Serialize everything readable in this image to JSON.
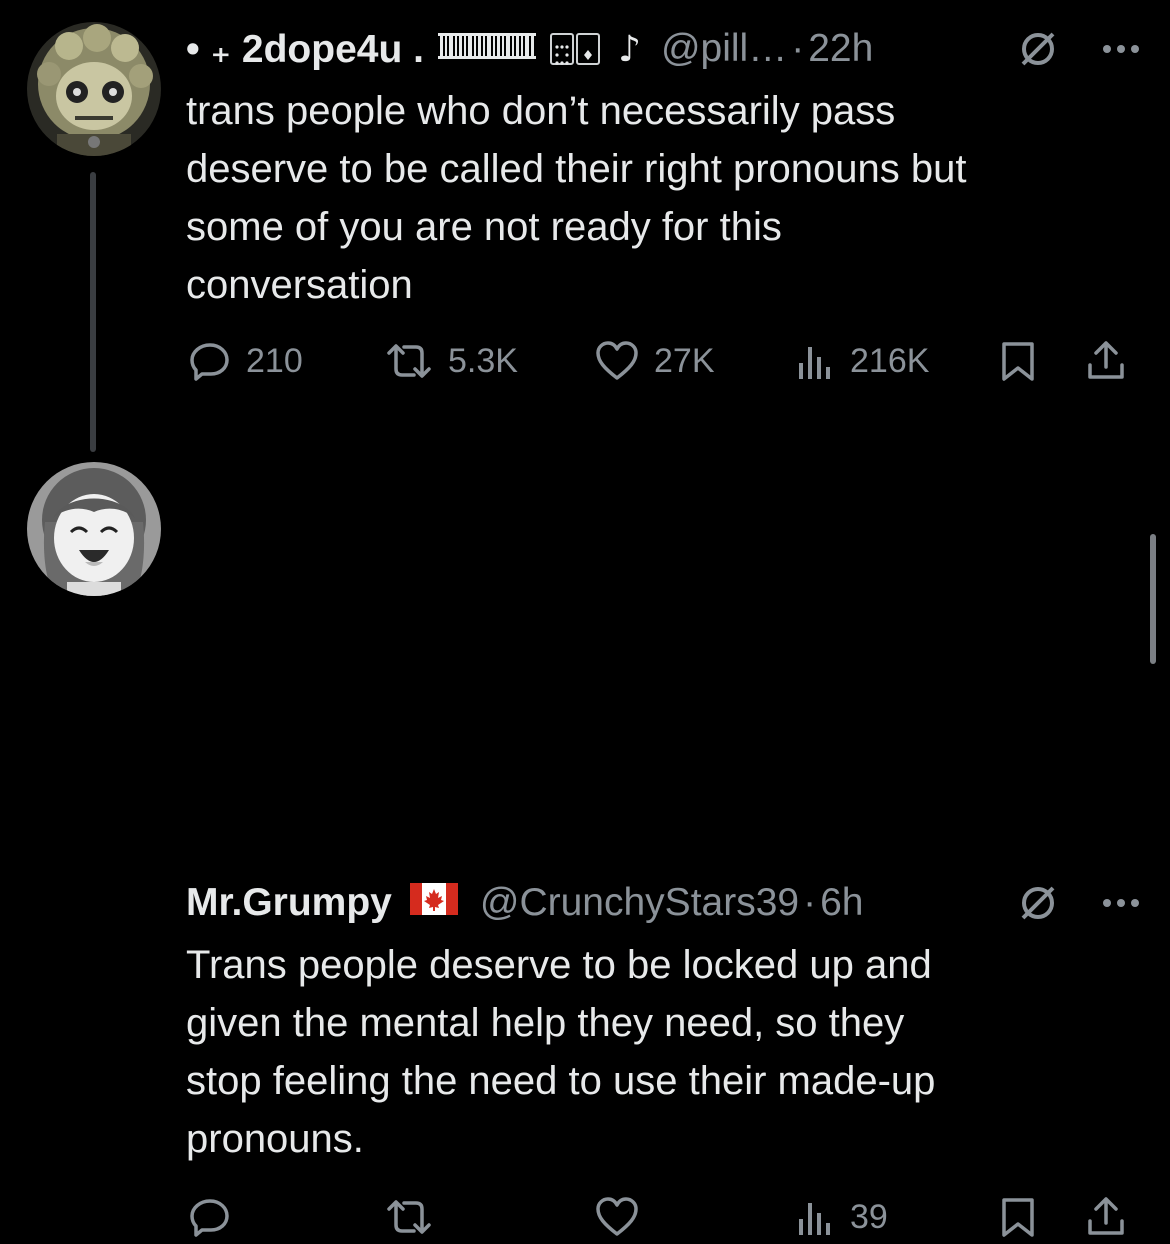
{
  "colors": {
    "background": "#000000",
    "text_primary": "#e7e9ea",
    "text_secondary": "#8b9299",
    "thread_line": "#3a3d41"
  },
  "tweets": [
    {
      "display_name": "• ₊ 2dope4u .",
      "decorations": [
        "barcode-icon",
        "playing-cards-icon",
        "music-note-icon"
      ],
      "music_note": "♪",
      "handle": "@pill…",
      "separator": "·",
      "time": "22h",
      "text": "trans people who don’t necessarily pass\ndeserve to be called their right pronouns but\nsome of you are not ready for this\nconversation",
      "stats": {
        "replies": "210",
        "retweets": "5.3K",
        "likes": "27K",
        "views": "216K"
      }
    },
    {
      "display_name": "Mr.Grumpy",
      "flag": "canada-flag-icon",
      "handle": "@CrunchyStars39",
      "separator": "·",
      "time": "6h",
      "text": "Trans people deserve to be locked up and\ngiven the mental help they need, so they\nstop feeling the need to use their made-up\npronouns.",
      "stats": {
        "replies": "",
        "retweets": "",
        "likes": "",
        "views": "39"
      }
    }
  ]
}
